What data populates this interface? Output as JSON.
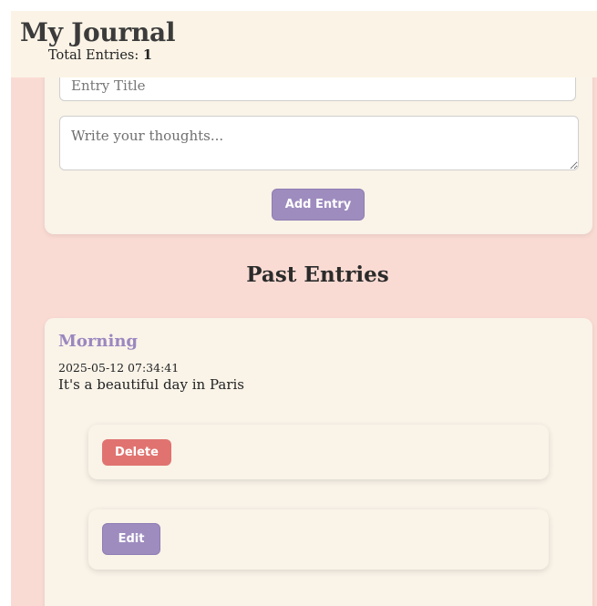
{
  "header": {
    "title": "My Journal",
    "total_label": "Total Entries:",
    "total_count": "1"
  },
  "form": {
    "title_placeholder": "Entry Title",
    "title_value": "",
    "thoughts_placeholder": "Write your thoughts...",
    "thoughts_value": "",
    "add_button_label": "Add Entry"
  },
  "past_entries": {
    "heading": "Past Entries",
    "entries": [
      {
        "title": "Morning",
        "date": "2025-05-12 07:34:41",
        "body": "It's a beautiful day in Paris",
        "delete_label": "Delete",
        "edit_label": "Edit"
      }
    ]
  },
  "colors": {
    "page_background": "#fadbd3",
    "card_background": "#f9f3e8",
    "accent_purple": "#9e8cbf",
    "delete_red": "#e07370"
  }
}
